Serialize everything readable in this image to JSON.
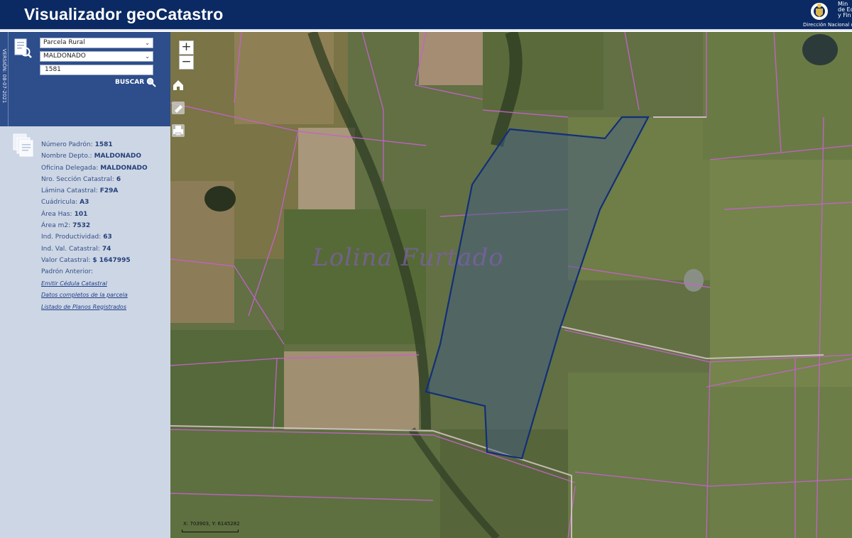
{
  "header": {
    "title": "Visualizador geoCatastro",
    "gov_text": "Min\nde Ec\ny Fin",
    "gov_dir": "Dirección Nacional d"
  },
  "sidebar": {
    "version": "VERSIÓN: 08-07-2021",
    "search": {
      "type_value": "Parcela Rural",
      "depto_value": "MALDONADO",
      "padron_value": "1581",
      "button_label": "BUSCAR"
    },
    "info": [
      {
        "label": "Número Padrón:",
        "value": "1581"
      },
      {
        "label": "Nombre Depto.:",
        "value": "MALDONADO"
      },
      {
        "label": "Oficina Delegada:",
        "value": "MALDONADO"
      },
      {
        "label": "Nro. Sección Catastral:",
        "value": "6"
      },
      {
        "label": "Lámina Catastral:",
        "value": "F29A"
      },
      {
        "label": "Cuádricula:",
        "value": "A3"
      },
      {
        "label": "Área Has:",
        "value": "101"
      },
      {
        "label": "Área m2:",
        "value": "7532"
      },
      {
        "label": "Ind. Productividad:",
        "value": "63"
      },
      {
        "label": "Ind. Val. Catastral:",
        "value": "74"
      },
      {
        "label": "Valor Catastral:",
        "value": "$ 1647995"
      },
      {
        "label": "Padrón Anterior:",
        "value": ""
      }
    ],
    "links": [
      "Emitir Cédula Catastral",
      "Datos completos de la parcela",
      "Listado de Planos Registrados"
    ]
  },
  "map": {
    "zoom_in": "+",
    "zoom_out": "−",
    "watermark": "Lolina Furtado",
    "coords": "X: 703903, Y: 6145282"
  },
  "colors": {
    "header_bg": "#0b2a63",
    "panel_blue": "#2d4d8b",
    "panel_light": "#cdd6e4",
    "parcel_line": "#d06ad8",
    "selected_parcel": "#1a3c86"
  }
}
